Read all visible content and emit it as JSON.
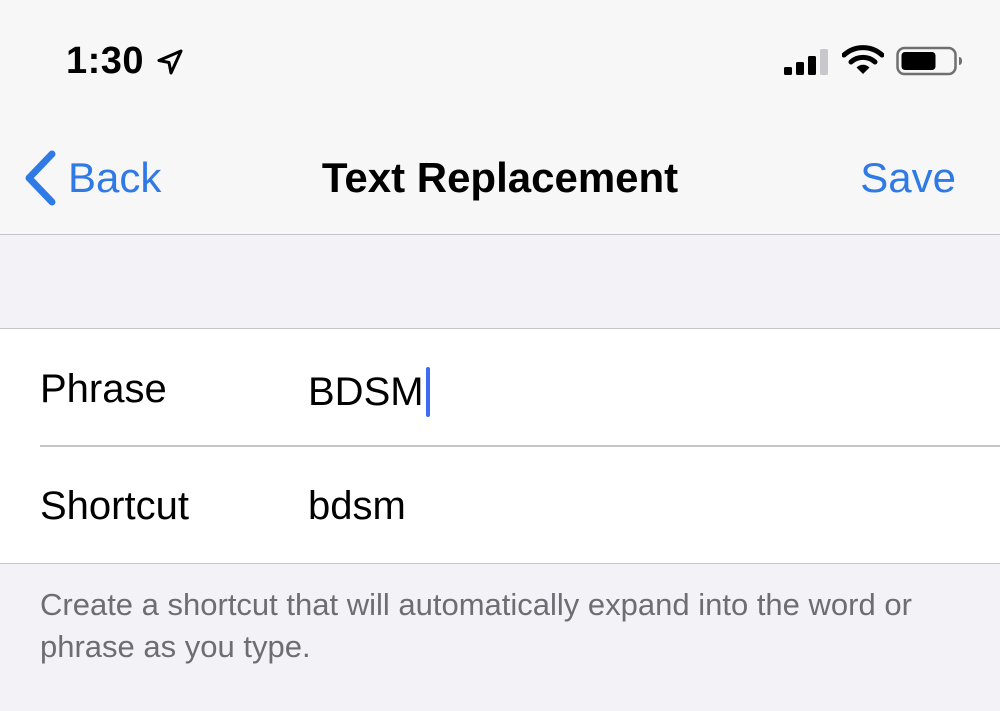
{
  "status_bar": {
    "time": "1:30",
    "location_icon": "location-arrow-icon",
    "signal_icon": "cellular-signal-icon",
    "wifi_icon": "wifi-icon",
    "battery_icon": "battery-icon"
  },
  "nav": {
    "back_label": "Back",
    "title": "Text Replacement",
    "save_label": "Save"
  },
  "form": {
    "phrase_label": "Phrase",
    "phrase_value": "BDSM",
    "shortcut_label": "Shortcut",
    "shortcut_value": "bdsm"
  },
  "footer": {
    "note": "Create a shortcut that will automatically expand into the word or phrase as you type."
  },
  "colors": {
    "accent": "#2f7ae5",
    "cursor": "#3a6df0",
    "background": "#f2f2f7",
    "secondary_text": "#6d6d72"
  }
}
